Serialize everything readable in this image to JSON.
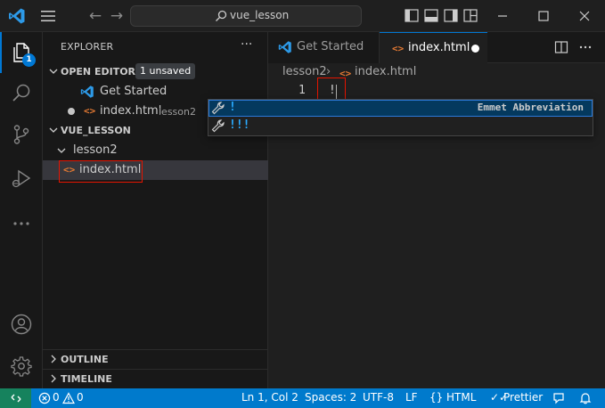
{
  "titlebar": {
    "search_text": "vue_lesson"
  },
  "activity": {
    "explorer_badge": "1"
  },
  "sidebar": {
    "title": "EXPLORER",
    "more": "···",
    "open_editors": {
      "label": "OPEN EDITORS",
      "badge": "1 unsaved",
      "items": [
        {
          "name": "Get Started"
        },
        {
          "name": "index.html",
          "folder": "lesson2"
        }
      ]
    },
    "workspace": {
      "label": "VUE_LESSON",
      "folder": "lesson2",
      "file": "index.html"
    },
    "outline_label": "OUTLINE",
    "timeline_label": "TIMELINE"
  },
  "tabs": [
    {
      "label": "Get Started"
    },
    {
      "label": "index.html"
    }
  ],
  "breadcrumb": {
    "folder": "lesson2",
    "file": "index.html"
  },
  "editor": {
    "line_number": "1",
    "code": "!"
  },
  "suggest": {
    "items": [
      {
        "label": "!",
        "detail": "Emmet Abbreviation"
      },
      {
        "label": "!!!"
      }
    ]
  },
  "status": {
    "errors": "0",
    "warnings": "0",
    "position": "Ln 1, Col 2",
    "spaces": "Spaces: 2",
    "encoding": "UTF-8",
    "eol": "LF",
    "language": "HTML",
    "prettier": "Prettier"
  },
  "colors": {
    "accent": "#007acc",
    "remote": "#16825d",
    "html_icon": "#e37933",
    "highlight_box": "#e51400"
  }
}
